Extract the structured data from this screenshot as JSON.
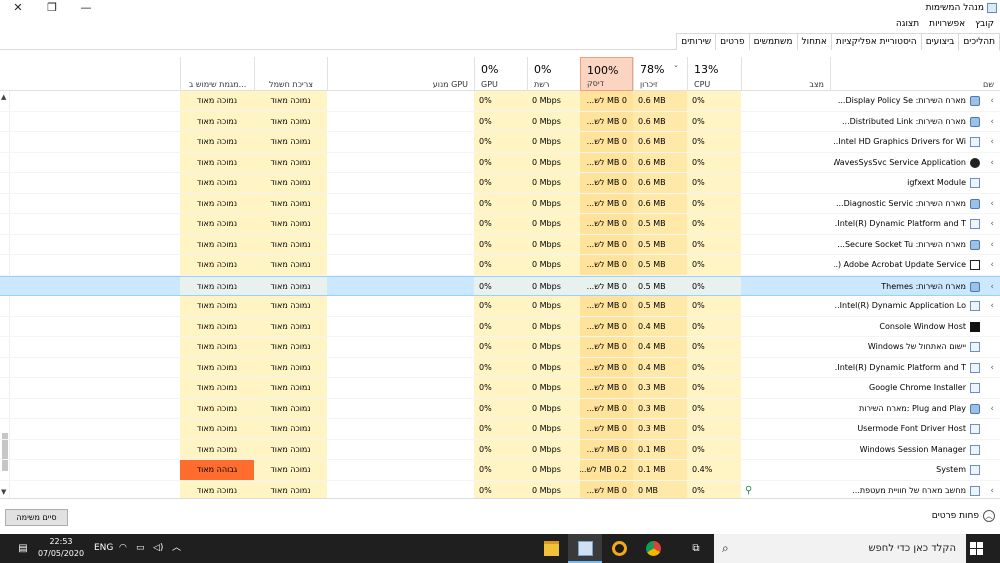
{
  "window": {
    "title": "מנהל המשימות"
  },
  "menu": [
    "קובץ",
    "אפשרויות",
    "תצוגה"
  ],
  "tabs": [
    {
      "label": "תהליכים",
      "active": true
    },
    {
      "label": "ביצועים"
    },
    {
      "label": "היסטוריית אפליקציות"
    },
    {
      "label": "אתחול"
    },
    {
      "label": "משתמשים"
    },
    {
      "label": "פרטים"
    },
    {
      "label": "שירותים"
    }
  ],
  "columns": {
    "name": "שם",
    "status": "מצב",
    "cpu": {
      "pct": "13%",
      "label": "CPU"
    },
    "memory": {
      "pct": "78%",
      "label": "זיכרון"
    },
    "disk": {
      "pct": "100%",
      "label": "דיסק"
    },
    "network": {
      "pct": "0%",
      "label": "רשת"
    },
    "gpu": {
      "pct": "0%",
      "label": "GPU"
    },
    "gpu_engine": "מנוע GPU",
    "power": "צריכת חשמל",
    "power_trend": "מגמת שימוש ב..."
  },
  "rows": [
    {
      "name": "מארח השירות: Display Policy Se...",
      "icon": "gear",
      "chev": true,
      "cpu": "0%",
      "mem": "0.6 MB",
      "disk": "0 MB לש...",
      "net": "0 Mbps",
      "gpu": "0%",
      "power": "נמוכה מאוד",
      "trend": "נמוכה מאוד"
    },
    {
      "name": "מארח השירות: Distributed Link...",
      "icon": "gear",
      "chev": true,
      "cpu": "0%",
      "mem": "0.6 MB",
      "disk": "0 MB לש...",
      "net": "0 Mbps",
      "gpu": "0%",
      "power": "נמוכה מאוד",
      "trend": "נמוכה מאוד"
    },
    {
      "name": "Intel HD Graphics Drivers for Wi...",
      "icon": "box",
      "chev": true,
      "cpu": "0%",
      "mem": "0.6 MB",
      "disk": "0 MB לש...",
      "net": "0 Mbps",
      "gpu": "0%",
      "power": "נמוכה מאוד",
      "trend": "נמוכה מאוד"
    },
    {
      "name": "WavesSysSvc Service Application",
      "icon": "wave",
      "chev": true,
      "cpu": "0%",
      "mem": "0.6 MB",
      "disk": "0 MB לש...",
      "net": "0 Mbps",
      "gpu": "0%",
      "power": "נמוכה מאוד",
      "trend": "נמוכה מאוד"
    },
    {
      "name": "igfxext Module",
      "icon": "box",
      "chev": false,
      "cpu": "0%",
      "mem": "0.6 MB",
      "disk": "0 MB לש...",
      "net": "0 Mbps",
      "gpu": "0%",
      "power": "נמוכה מאוד",
      "trend": "נמוכה מאוד"
    },
    {
      "name": "מארח השירות: Diagnostic Servic...",
      "icon": "gear",
      "chev": true,
      "cpu": "0%",
      "mem": "0.6 MB",
      "disk": "0 MB לש...",
      "net": "0 Mbps",
      "gpu": "0%",
      "power": "נמוכה מאוד",
      "trend": "נמוכה מאוד"
    },
    {
      "name": "Intel(R) Dynamic Platform and T...",
      "icon": "box",
      "chev": true,
      "cpu": "0%",
      "mem": "0.5 MB",
      "disk": "0 MB לש...",
      "net": "0 Mbps",
      "gpu": "0%",
      "power": "נמוכה מאוד",
      "trend": "נמוכה מאוד"
    },
    {
      "name": "מארח השירות: Secure Socket Tu...",
      "icon": "gear",
      "chev": true,
      "cpu": "0%",
      "mem": "0.5 MB",
      "disk": "0 MB לש...",
      "net": "0 Mbps",
      "gpu": "0%",
      "power": "נמוכה מאוד",
      "trend": "נמוכה מאוד"
    },
    {
      "name": "Adobe Acrobat Update Service (...",
      "icon": "outline",
      "chev": true,
      "cpu": "0%",
      "mem": "0.5 MB",
      "disk": "0 MB לש...",
      "net": "0 Mbps",
      "gpu": "0%",
      "power": "נמוכה מאוד",
      "trend": "נמוכה מאוד"
    },
    {
      "name": "מארח השירות: Themes",
      "icon": "gear",
      "chev": true,
      "cpu": "0%",
      "mem": "0.5 MB",
      "disk": "0 MB לש...",
      "net": "0 Mbps",
      "gpu": "0%",
      "power": "נמוכה מאוד",
      "trend": "נמוכה מאוד",
      "selected": true
    },
    {
      "name": "Intel(R) Dynamic Application Lo...",
      "icon": "box",
      "chev": true,
      "cpu": "0%",
      "mem": "0.5 MB",
      "disk": "0 MB לש...",
      "net": "0 Mbps",
      "gpu": "0%",
      "power": "נמוכה מאוד",
      "trend": "נמוכה מאוד"
    },
    {
      "name": "Console Window Host",
      "icon": "dark",
      "chev": false,
      "cpu": "0%",
      "mem": "0.4 MB",
      "disk": "0 MB לש...",
      "net": "0 Mbps",
      "gpu": "0%",
      "power": "נמוכה מאוד",
      "trend": "נמוכה מאוד"
    },
    {
      "name": "יישום האתחול של Windows",
      "icon": "box",
      "chev": false,
      "cpu": "0%",
      "mem": "0.4 MB",
      "disk": "0 MB לש...",
      "net": "0 Mbps",
      "gpu": "0%",
      "power": "נמוכה מאוד",
      "trend": "נמוכה מאוד"
    },
    {
      "name": "Intel(R) Dynamic Platform and T...",
      "icon": "box",
      "chev": true,
      "cpu": "0%",
      "mem": "0.4 MB",
      "disk": "0 MB לש...",
      "net": "0 Mbps",
      "gpu": "0%",
      "power": "נמוכה מאוד",
      "trend": "נמוכה מאוד"
    },
    {
      "name": "Google Chrome Installer",
      "icon": "box",
      "chev": false,
      "cpu": "0%",
      "mem": "0.3 MB",
      "disk": "0 MB לש...",
      "net": "0 Mbps",
      "gpu": "0%",
      "power": "נמוכה מאוד",
      "trend": "נמוכה מאוד"
    },
    {
      "name": "Plug and Play :מארח השירות",
      "icon": "gear",
      "chev": true,
      "cpu": "0%",
      "mem": "0.3 MB",
      "disk": "0 MB לש...",
      "net": "0 Mbps",
      "gpu": "0%",
      "power": "נמוכה מאוד",
      "trend": "נמוכה מאוד"
    },
    {
      "name": "Usermode Font Driver Host",
      "icon": "box",
      "chev": false,
      "cpu": "0%",
      "mem": "0.3 MB",
      "disk": "0 MB לש...",
      "net": "0 Mbps",
      "gpu": "0%",
      "power": "נמוכה מאוד",
      "trend": "נמוכה מאוד"
    },
    {
      "name": "Windows Session Manager",
      "icon": "box",
      "chev": false,
      "cpu": "0%",
      "mem": "0.1 MB",
      "disk": "0 MB לש...",
      "net": "0 Mbps",
      "gpu": "0%",
      "power": "נמוכה מאוד",
      "trend": "נמוכה מאוד"
    },
    {
      "name": "System",
      "icon": "box",
      "chev": false,
      "cpu": "0.4%",
      "mem": "0.1 MB",
      "disk": "0.2 MB לש...",
      "net": "0 Mbps",
      "gpu": "0%",
      "power": "נמוכה מאוד",
      "trend": "גבוהה מאוד",
      "trendHigh": true
    },
    {
      "name": "מחשב מארח של חוויית מעטפת...",
      "icon": "box",
      "chev": true,
      "cpu": "0%",
      "mem": "0 MB",
      "disk": "0 MB לש...",
      "net": "0 Mbps",
      "gpu": "0%",
      "power": "נמוכה מאוד",
      "trend": "נמוכה מאוד",
      "leaf": true
    }
  ],
  "footer": {
    "fewer_details": "פחות פרטים",
    "end_task": "סיים משימה"
  },
  "taskbar": {
    "search_placeholder": "הקלד כאן כדי לחפש",
    "time": "22:53",
    "date": "07/05/2020",
    "lang": "ENG"
  }
}
